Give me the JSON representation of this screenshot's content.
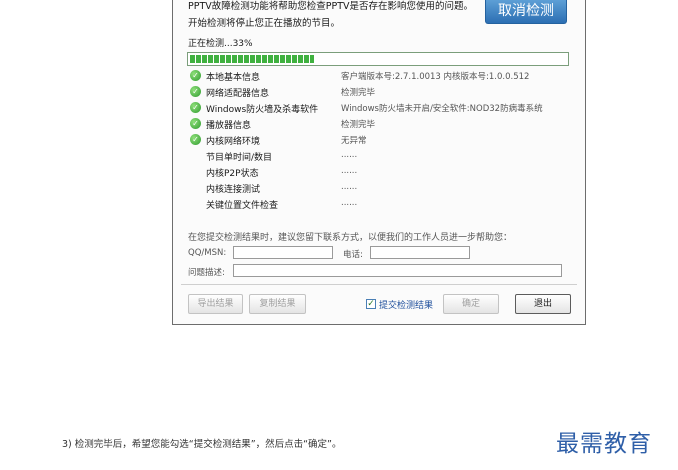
{
  "dialog": {
    "intro_line1": "PPTV故障检测功能将帮助您检查PPTV是否存在影响您使用的问题。",
    "intro_line2": "开始检测将停止您正在播放的节目。",
    "cancel_button": "取消检测",
    "status_text": "正在检测...33%",
    "progress_fraction": 0.33,
    "checks": [
      {
        "label": "本地基本信息",
        "status": "客户端版本号:2.7.1.0013  内核版本号:1.0.0.512",
        "done": true
      },
      {
        "label": "网络适配器信息",
        "status": "检测完毕",
        "done": true
      },
      {
        "label": "Windows防火墙及杀毒软件",
        "status": "Windows防火墙未开启/安全软件:NOD32防病毒系统",
        "done": true
      },
      {
        "label": "播放器信息",
        "status": "检测完毕",
        "done": true
      },
      {
        "label": "内核网络环境",
        "status": "无异常",
        "done": true
      },
      {
        "label": "节目单时间/数目",
        "status": "......",
        "done": false
      },
      {
        "label": "内核P2P状态",
        "status": "......",
        "done": false
      },
      {
        "label": "内核连接测试",
        "status": "......",
        "done": false
      },
      {
        "label": "关键位置文件检查",
        "status": "......",
        "done": false
      }
    ],
    "feedback_note": "在您提交检测结果时，建议您留下联系方式，以便我们的工作人员进一步帮助您：",
    "qq_label": "QQ/MSN:",
    "qq_value": "",
    "phone_label": "电话:",
    "phone_value": "",
    "desc_label": "问题描述:",
    "desc_value": "",
    "export_button": "导出结果",
    "copy_button": "复制结果",
    "submit_checkbox_label": "提交检测结果",
    "submit_checked": true,
    "ok_button": "确定",
    "exit_button": "退出"
  },
  "caption": "3) 检测完毕后，希望您能勾选“提交检测结果”，然后点击“确定”。",
  "watermark": "最需教育",
  "colors": {
    "accent_blue": "#2c6fb3",
    "progress_green": "#3fb13f",
    "check_green": "#2f9a2f"
  }
}
